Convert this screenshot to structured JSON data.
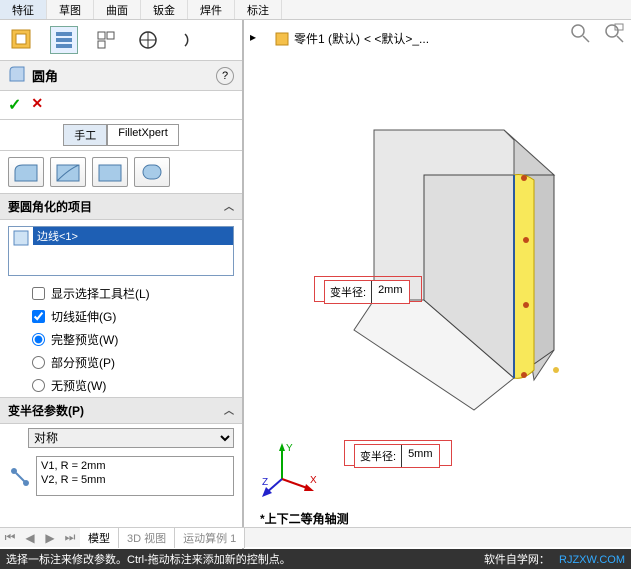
{
  "tabs": {
    "items": [
      "特征",
      "草图",
      "曲面",
      "钣金",
      "焊件",
      "标注"
    ],
    "active": 0
  },
  "breadcrumb": {
    "part": "零件1 (默认)",
    "state": "< <默认>_..."
  },
  "feature_panel": {
    "title": "圆角",
    "mode_tabs": {
      "manual": "手工",
      "xpert": "FilletXpert"
    },
    "sections": {
      "items_header": "要圆角化的项目",
      "params_header": "变半径参数(P)"
    },
    "selection": {
      "edge1": "边线<1>"
    },
    "options": {
      "show_toolbar": "显示选择工具栏(L)",
      "tangent_prop": "切线延伸(G)",
      "full_preview": "完整预览(W)",
      "partial_preview": "部分预览(P)",
      "no_preview": "无预览(W)"
    },
    "symmetry": "对称",
    "vertices": {
      "v1": "V1, R = 2mm",
      "v2": "V2, R = 5mm"
    }
  },
  "callouts": {
    "radius_label": "变半径:",
    "top_value": "2mm",
    "bottom_value": "5mm"
  },
  "viewport": {
    "orientation_label": "*上下二等角轴测"
  },
  "bottom_tabs": {
    "model": "模型",
    "view3d": "3D 视图",
    "motion": "运动算例 1"
  },
  "status_bar": {
    "hint": "选择一标注来修改参数。Ctrl-拖动标注来添加新的控制点。",
    "site": "软件自学网：",
    "url": "RJZXW.COM"
  }
}
